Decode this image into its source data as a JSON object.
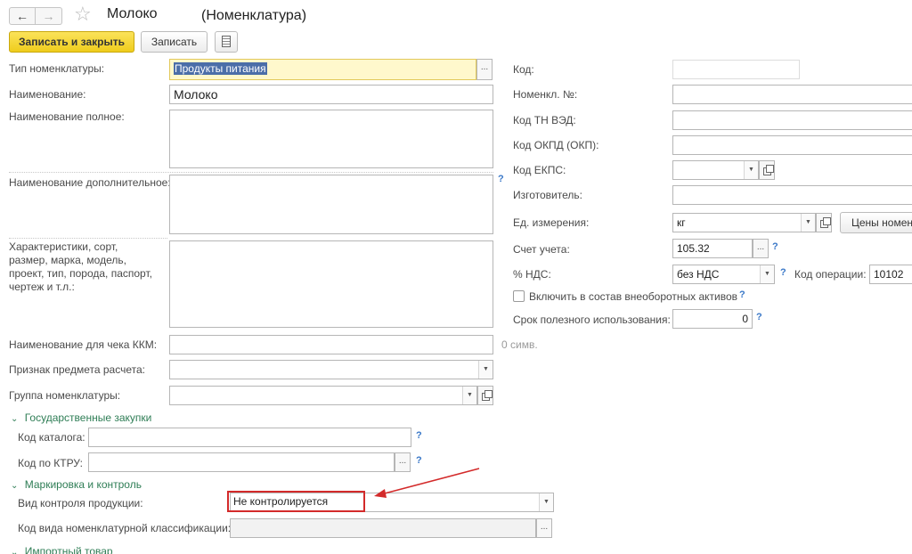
{
  "window": {
    "title": "Молоко",
    "subtitle": "(Номенклатура)"
  },
  "toolbar": {
    "save_close_label": "Записать и закрыть",
    "save_label": "Записать"
  },
  "left": {
    "type_label": "Тип номенклатуры:",
    "type_value": "Продукты питания",
    "name_label": "Наименование:",
    "name_value": "Молоко",
    "fullname_label": "Наименование полное:",
    "extra_name_label": "Наименование дополнительное:",
    "characteristics_label": "Характеристики, сорт, размер, марка, модель, проект, тип, порода, паспорт, чертеж и т.л.:",
    "kkm_label": "Наименование для чека ККМ:",
    "kkm_counter": "0 симв.",
    "payment_subject_label": "Признак предмета расчета:",
    "group_label": "Группа номенклатуры:",
    "q": "?"
  },
  "gos": {
    "header": "Государственные закупки",
    "catalog_label": "Код каталога:",
    "ktru_label": "Код по КТРУ:"
  },
  "marking": {
    "header": "Маркировка и контроль",
    "control_label": "Вид контроля продукции:",
    "control_value": "Не контролируется",
    "classifier_label": "Код вида номенклатурной классификации:"
  },
  "bottom_group": {
    "header": "Импортный товар"
  },
  "right": {
    "code_label": "Код:",
    "nomnum_label": "Номенкл. №:",
    "tnved_label": "Код ТН ВЭД:",
    "okpd_label": "Код ОКПД (ОКП):",
    "ekps_label": "Код ЕКПС:",
    "maker_label": "Изготовитель:",
    "unit_label": "Ед. измерения:",
    "unit_value": "кг",
    "prices_label": "Цены номенклатуры",
    "account_label": "Счет учета:",
    "account_value": "105.32",
    "vat_label": "% НДС:",
    "vat_value": "без НДС",
    "opcode_label": "Код операции:",
    "opcode_value": "10102",
    "fixed_assets_label": "Включить в состав внеоборотных активов",
    "life_label": "Срок полезного использования:",
    "life_value": "0"
  },
  "icons": {
    "back": "arrow-left-icon",
    "forward": "arrow-right-icon",
    "star": "star-icon",
    "doc": "document-list-icon"
  },
  "colors": {
    "primary_button": "#f4d531",
    "highlight_field": "#fff8cc",
    "selection": "#4b6ea8",
    "group_header": "#2e7d55",
    "help": "#3a78c8",
    "annotation": "#d32a2a"
  }
}
